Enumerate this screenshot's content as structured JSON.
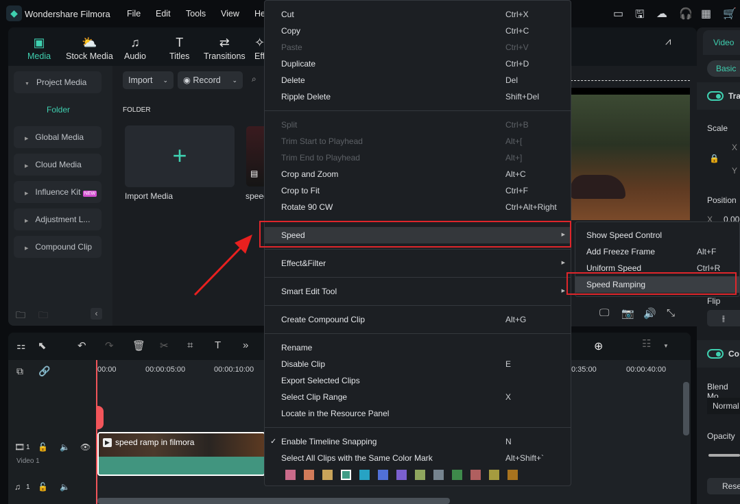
{
  "app": {
    "title": "Wondershare Filmora",
    "menu": [
      "File",
      "Edit",
      "Tools",
      "View",
      "He"
    ]
  },
  "toolbar_tabs": [
    {
      "label": "Media",
      "icon": "media-icon",
      "active": true
    },
    {
      "label": "Stock Media",
      "icon": "cloud-folder-icon"
    },
    {
      "label": "Audio",
      "icon": "music-note-icon"
    },
    {
      "label": "Titles",
      "icon": "text-icon"
    },
    {
      "label": "Transitions",
      "icon": "transition-icon"
    },
    {
      "label": "Eff",
      "icon": "effects-icon"
    }
  ],
  "sidebar": {
    "project_media": "Project Media",
    "folder": "Folder",
    "items": [
      "Global Media",
      "Cloud Media",
      "Influence Kit",
      "Adjustment L...",
      "Compound Clip"
    ],
    "new_badge": "NEW"
  },
  "media": {
    "import_label": "Import",
    "record_label": "Record",
    "folder_heading": "FOLDER",
    "import_media": "Import Media",
    "clip_name": "speed"
  },
  "right_panel": {
    "tab_video": "Video",
    "tab_basic": "Basic",
    "transform": "Tra",
    "scale": "Scale",
    "x": "X",
    "y": "Y",
    "position": "Position",
    "pos_x_value": "0.00",
    "flip": "Flip",
    "compositing": "Co",
    "blend_mode": "Blend Mo",
    "blend_value": "Normal",
    "opacity": "Opacity",
    "reset": "Reset"
  },
  "timeline": {
    "ruler": [
      "00:00",
      "00:00:05:00",
      "00:00:10:00",
      "0:35:00",
      "00:00:40:00"
    ],
    "clip_title": "speed ramp in filmora",
    "video_track": "Video 1",
    "track_num": "1"
  },
  "context_menu": {
    "groups": [
      [
        {
          "label": "Cut",
          "shortcut": "Ctrl+X"
        },
        {
          "label": "Copy",
          "shortcut": "Ctrl+C"
        },
        {
          "label": "Paste",
          "shortcut": "Ctrl+V",
          "disabled": true
        },
        {
          "label": "Duplicate",
          "shortcut": "Ctrl+D"
        },
        {
          "label": "Delete",
          "shortcut": "Del"
        },
        {
          "label": "Ripple Delete",
          "shortcut": "Shift+Del"
        }
      ],
      [
        {
          "label": "Split",
          "shortcut": "Ctrl+B",
          "disabled": true
        },
        {
          "label": "Trim Start to Playhead",
          "shortcut": "Alt+[",
          "disabled": true
        },
        {
          "label": "Trim End to Playhead",
          "shortcut": "Alt+]",
          "disabled": true
        },
        {
          "label": "Crop and Zoom",
          "shortcut": "Alt+C"
        },
        {
          "label": "Crop to Fit",
          "shortcut": "Ctrl+F"
        },
        {
          "label": "Rotate 90 CW",
          "shortcut": "Ctrl+Alt+Right"
        }
      ],
      [
        {
          "label": "Speed",
          "submenu": true,
          "highlighted": true
        }
      ],
      [
        {
          "label": "Effect&Filter",
          "submenu": true
        }
      ],
      [
        {
          "label": "Smart Edit Tool",
          "submenu": true
        }
      ],
      [
        {
          "label": "Create Compound Clip",
          "shortcut": "Alt+G"
        }
      ],
      [
        {
          "label": "Rename"
        },
        {
          "label": "Disable Clip",
          "shortcut": "E"
        },
        {
          "label": "Export Selected Clips"
        },
        {
          "label": "Select Clip Range",
          "shortcut": "X"
        },
        {
          "label": "Locate in the Resource Panel"
        }
      ],
      [
        {
          "label": "Enable Timeline Snapping",
          "shortcut": "N",
          "checked": true
        },
        {
          "label": "Select All Clips with the Same Color Mark",
          "shortcut": "Alt+Shift+`"
        }
      ]
    ],
    "color_marks": [
      "#c96a8a",
      "#d27b5a",
      "#c9a45a",
      "#3f9c86",
      "#27a3c4",
      "#5170d8",
      "#7b60cf",
      "#8fa65e",
      "#76848f",
      "#3e8a4b",
      "#b05f5f",
      "#a59b3f",
      "#a8731e"
    ],
    "selected_color_index": 3
  },
  "speed_submenu": [
    {
      "label": "Show Speed Control"
    },
    {
      "label": "Add Freeze Frame",
      "shortcut": "Alt+F"
    },
    {
      "label": "Uniform Speed",
      "shortcut": "Ctrl+R"
    },
    {
      "label": "Speed Ramping",
      "highlighted": true
    }
  ],
  "colors": {
    "accent": "#3fd0b0",
    "highlight_box": "#e0262b"
  }
}
